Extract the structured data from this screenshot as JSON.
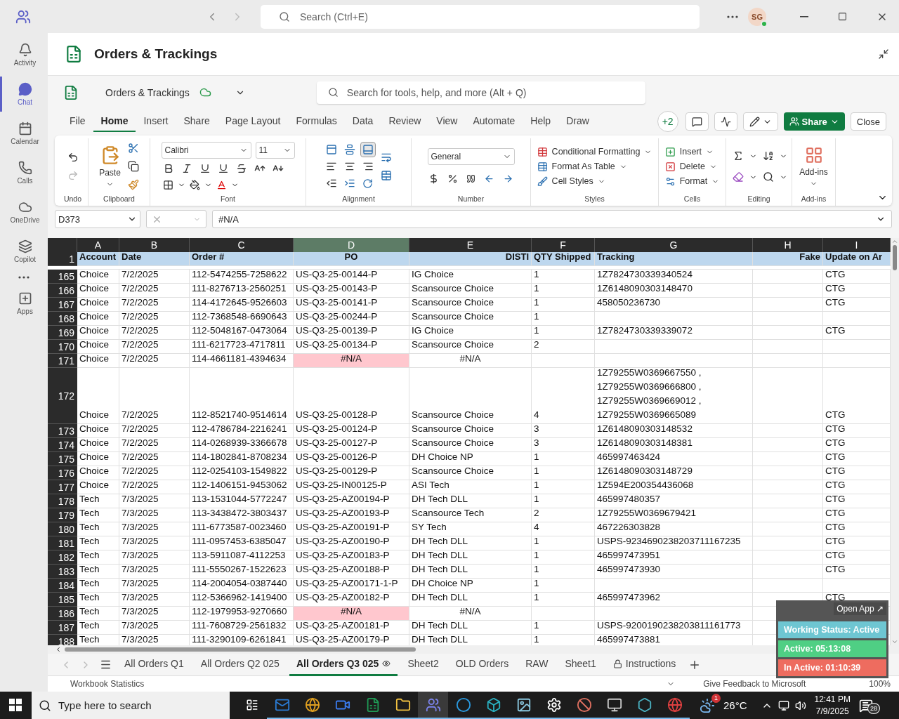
{
  "teams_bar": {
    "search": {
      "placeholder": "Search (Ctrl+E)"
    },
    "avatar": "SG"
  },
  "rail": [
    {
      "label": "Activity",
      "selected": false
    },
    {
      "label": "Chat",
      "selected": true
    },
    {
      "label": "Calendar",
      "selected": false
    },
    {
      "label": "Calls",
      "selected": false
    },
    {
      "label": "OneDrive",
      "selected": false
    },
    {
      "label": "Copilot",
      "selected": false
    },
    {
      "label": "Apps",
      "selected": false
    }
  ],
  "title": "Orders & Trackings",
  "workbook": {
    "name": "Orders & Trackings",
    "search": {
      "placeholder": "Search for tools, help, and more (Alt + Q)"
    }
  },
  "menu_tabs": [
    {
      "label": "File",
      "selected": false
    },
    {
      "label": "Home",
      "selected": true
    },
    {
      "label": "Insert",
      "selected": false
    },
    {
      "label": "Share",
      "selected": false
    },
    {
      "label": "Page Layout",
      "selected": false
    },
    {
      "label": "Formulas",
      "selected": false
    },
    {
      "label": "Data",
      "selected": false
    },
    {
      "label": "Review",
      "selected": false
    },
    {
      "label": "View",
      "selected": false
    },
    {
      "label": "Automate",
      "selected": false
    },
    {
      "label": "Help",
      "selected": false
    },
    {
      "label": "Draw",
      "selected": false
    }
  ],
  "collaborators": "+2",
  "share_button": "Share",
  "close_button": "Close",
  "ribbon": [
    {
      "kind": "undo",
      "label": "Undo"
    },
    {
      "kind": "clipboard",
      "label": "Clipboard",
      "button": "Paste"
    },
    {
      "kind": "font",
      "label": "Font",
      "font": "Calibri",
      "size": "11"
    },
    {
      "kind": "alignment",
      "label": "Alignment",
      "vertical": [
        {
          "selected": false
        },
        {
          "selected": false
        },
        {
          "selected": true
        }
      ]
    },
    {
      "kind": "number",
      "label": "Number",
      "format": "General"
    },
    {
      "kind": "styles",
      "label": "Styles",
      "buttons": [
        "Conditional Formatting",
        "Format As Table",
        "Cell Styles"
      ]
    },
    {
      "kind": "cells",
      "label": "Cells",
      "buttons": [
        "Insert",
        "Delete",
        "Format"
      ]
    },
    {
      "kind": "editing",
      "label": "Editing"
    },
    {
      "kind": "addins",
      "label": "Add-ins",
      "button": "Add-ins"
    }
  ],
  "formula_bar": {
    "name_box": "D373",
    "value": "#N/A"
  },
  "columns": [
    {
      "letter": "A",
      "selected": false
    },
    {
      "letter": "B",
      "selected": false
    },
    {
      "letter": "C",
      "selected": false
    },
    {
      "letter": "D",
      "selected": true
    },
    {
      "letter": "E",
      "selected": false
    },
    {
      "letter": "F",
      "selected": false
    },
    {
      "letter": "G",
      "selected": false
    },
    {
      "letter": "H",
      "selected": false
    },
    {
      "letter": "I",
      "selected": false
    }
  ],
  "header_row": {
    "num": "1",
    "cells": [
      "Account",
      "Date",
      "Order #",
      "PO",
      "DISTI",
      "QTY Shipped",
      "Tracking",
      "Fake",
      "Update on Ar"
    ]
  },
  "rows": [
    {
      "num": "165",
      "po_error": false,
      "cells": [
        "Choice",
        "7/2/2025",
        "112-5474255-7258622",
        "US-Q3-25-00144-P",
        "IG Choice",
        "1",
        "1Z7824730339340524",
        "",
        "CTG"
      ]
    },
    {
      "num": "166",
      "po_error": false,
      "cells": [
        "Choice",
        "7/2/2025",
        "111-8276713-2560251",
        "US-Q3-25-00143-P",
        "Scansource Choice",
        "1",
        "1Z6148090303148470",
        "",
        "CTG"
      ]
    },
    {
      "num": "167",
      "po_error": false,
      "cells": [
        "Choice",
        "7/2/2025",
        "114-4172645-9526603",
        "US-Q3-25-00141-P",
        "Scansource Choice",
        "1",
        "458050236730",
        "",
        "CTG"
      ]
    },
    {
      "num": "168",
      "po_error": false,
      "cells": [
        "Choice",
        "7/2/2025",
        "112-7368548-6690643",
        "US-Q3-25-00244-P",
        "Scansource Choice",
        "1",
        "",
        "",
        ""
      ]
    },
    {
      "num": "169",
      "po_error": false,
      "cells": [
        "Choice",
        "7/2/2025",
        "112-5048167-0473064",
        "US-Q3-25-00139-P",
        "IG Choice",
        "1",
        "1Z7824730339339072",
        "",
        "CTG"
      ]
    },
    {
      "num": "170",
      "po_error": false,
      "cells": [
        "Choice",
        "7/2/2025",
        "111-6217723-4717811",
        "US-Q3-25-00134-P",
        "Scansource Choice",
        "2",
        "",
        "",
        ""
      ]
    },
    {
      "num": "171",
      "po_error": true,
      "cells": [
        "Choice",
        "7/2/2025",
        "114-4661181-4394634",
        "#N/A",
        "#N/A",
        "",
        "",
        "",
        ""
      ]
    },
    {
      "num": "172",
      "po_error": false,
      "cells": [
        "Choice",
        "7/2/2025",
        "112-8521740-9514614",
        "US-Q3-25-00128-P",
        "Scansource Choice",
        "4",
        "1Z79255W0369667550 ,\n1Z79255W0369666800 ,\n1Z79255W0369669012 ,\n1Z79255W0369665089",
        "",
        "CTG"
      ]
    },
    {
      "num": "173",
      "po_error": false,
      "cells": [
        "Choice",
        "7/2/2025",
        "112-4786784-2216241",
        "US-Q3-25-00124-P",
        "Scansource Choice",
        "3",
        "1Z6148090303148532",
        "",
        "CTG"
      ]
    },
    {
      "num": "174",
      "po_error": false,
      "cells": [
        "Choice",
        "7/2/2025",
        "114-0268939-3366678",
        "US-Q3-25-00127-P",
        "Scansource Choice",
        "3",
        "1Z6148090303148381",
        "",
        "CTG"
      ]
    },
    {
      "num": "175",
      "po_error": false,
      "cells": [
        "Choice",
        "7/2/2025",
        "114-1802841-8708234",
        "US-Q3-25-00126-P",
        "DH Choice NP",
        "1",
        "465997463424",
        "",
        "CTG"
      ]
    },
    {
      "num": "176",
      "po_error": false,
      "cells": [
        "Choice",
        "7/2/2025",
        "112-0254103-1549822",
        "US-Q3-25-00129-P",
        "Scansource Choice",
        "1",
        "1Z6148090303148729",
        "",
        "CTG"
      ]
    },
    {
      "num": "177",
      "po_error": false,
      "cells": [
        "Choice",
        "7/2/2025",
        "112-1406151-9453062",
        "US-Q3-25-IN00125-P",
        "ASI Tech",
        "1",
        "1Z594E200354436068",
        "",
        "CTG"
      ]
    },
    {
      "num": "178",
      "po_error": false,
      "cells": [
        "Tech",
        "7/3/2025",
        "113-1531044-5772247",
        "US-Q3-25-AZ00194-P",
        "DH Tech DLL",
        "1",
        "465997480357",
        "",
        "CTG"
      ]
    },
    {
      "num": "179",
      "po_error": false,
      "cells": [
        "Tech",
        "7/3/2025",
        "113-3438472-3803437",
        "US-Q3-25-AZ00193-P",
        "Scansource Tech",
        "2",
        "1Z79255W0369679421",
        "",
        "CTG"
      ]
    },
    {
      "num": "180",
      "po_error": false,
      "cells": [
        "Tech",
        "7/3/2025",
        "111-6773587-0023460",
        "US-Q3-25-AZ00191-P",
        "SY Tech",
        "4",
        "467226303828",
        "",
        "CTG"
      ]
    },
    {
      "num": "181",
      "po_error": false,
      "cells": [
        "Tech",
        "7/3/2025",
        "111-0957453-6385047",
        "US-Q3-25-AZ00190-P",
        "DH Tech DLL",
        "1",
        "USPS-9234690238203711167235",
        "",
        "CTG"
      ]
    },
    {
      "num": "182",
      "po_error": false,
      "cells": [
        "Tech",
        "7/3/2025",
        "113-5911087-4112253",
        "US-Q3-25-AZ00183-P",
        "DH Tech DLL",
        "1",
        "465997473951",
        "",
        "CTG"
      ]
    },
    {
      "num": "183",
      "po_error": false,
      "cells": [
        "Tech",
        "7/3/2025",
        "111-5550267-1522623",
        "US-Q3-25-AZ00188-P",
        "DH Tech DLL",
        "1",
        "465997473930",
        "",
        "CTG"
      ]
    },
    {
      "num": "184",
      "po_error": false,
      "cells": [
        "Tech",
        "7/3/2025",
        "114-2004054-0387440",
        "US-Q3-25-AZ00171-1-P",
        "DH Choice NP",
        "1",
        "",
        "",
        ""
      ]
    },
    {
      "num": "185",
      "po_error": false,
      "cells": [
        "Tech",
        "7/3/2025",
        "112-5366962-1419400",
        "US-Q3-25-AZ00182-P",
        "DH Tech DLL",
        "1",
        "465997473962",
        "",
        "CTG"
      ]
    },
    {
      "num": "186",
      "po_error": true,
      "cells": [
        "Tech",
        "7/3/2025",
        "112-1979953-9270660",
        "#N/A",
        "#N/A",
        "",
        "",
        "",
        ""
      ]
    },
    {
      "num": "187",
      "po_error": false,
      "cells": [
        "Tech",
        "7/3/2025",
        "111-7608729-2561832",
        "US-Q3-25-AZ00181-P",
        "DH Tech DLL",
        "1",
        "USPS-9200190238203811161773",
        "",
        ""
      ]
    },
    {
      "num": "188",
      "po_error": false,
      "cells": [
        "Tech",
        "7/3/2025",
        "111-3290109-6261841",
        "US-Q3-25-AZ00179-P",
        "DH Tech DLL",
        "1",
        "465997473881",
        "",
        ""
      ]
    }
  ],
  "sheet_tabs": [
    {
      "label": "All Orders Q1",
      "selected": false,
      "kind": "plain"
    },
    {
      "label": "All Orders Q2 025",
      "selected": false,
      "kind": "plain"
    },
    {
      "label": "All Orders Q3 025",
      "selected": true,
      "kind": "watched"
    },
    {
      "label": "Sheet2",
      "selected": false,
      "kind": "plain"
    },
    {
      "label": "OLD Orders",
      "selected": false,
      "kind": "plain"
    },
    {
      "label": "RAW",
      "selected": false,
      "kind": "plain"
    },
    {
      "label": "Sheet1",
      "selected": false,
      "kind": "plain"
    },
    {
      "label": "Instructions",
      "selected": false,
      "kind": "locked"
    }
  ],
  "status_bar": {
    "left": "Workbook Statistics",
    "feedback": "Give Feedback to Microsoft",
    "zoom": "100%"
  },
  "tracker": {
    "open": "Open App ↗",
    "items": [
      {
        "label": "Working Status: Active",
        "color": "#6ec6d2"
      },
      {
        "label": "Active: 05:13:08",
        "color": "#4fcf84"
      },
      {
        "label": "In Active: 01:10:39",
        "color": "#ee6c5f"
      }
    ]
  },
  "taskbar": {
    "search": {
      "placeholder": "Type here to search"
    },
    "weather": "26°C",
    "weather_badge": "1",
    "time": "12:41 PM",
    "date": "7/9/2025",
    "notifications": "28"
  }
}
